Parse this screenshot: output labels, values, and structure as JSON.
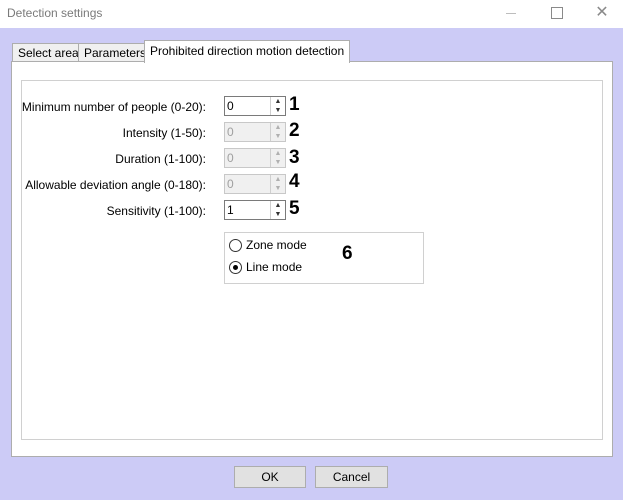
{
  "window": {
    "title": "Detection settings"
  },
  "tabs": [
    {
      "label": "Select area"
    },
    {
      "label": "Parameters"
    },
    {
      "label": "Prohibited direction motion detection"
    }
  ],
  "fields": [
    {
      "label": "Minimum number of people (0-20):",
      "value": "0",
      "enabled": true,
      "marker": "1"
    },
    {
      "label": "Intensity (1-50):",
      "value": "0",
      "enabled": false,
      "marker": "2"
    },
    {
      "label": "Duration (1-100):",
      "value": "0",
      "enabled": false,
      "marker": "3"
    },
    {
      "label": "Allowable deviation angle (0-180):",
      "value": "0",
      "enabled": false,
      "marker": "4"
    },
    {
      "label": "Sensitivity (1-100):",
      "value": "1",
      "enabled": true,
      "marker": "5"
    }
  ],
  "mode": {
    "options": [
      {
        "label": "Zone mode",
        "selected": false
      },
      {
        "label": "Line mode",
        "selected": true
      }
    ],
    "marker": "6"
  },
  "buttons": {
    "ok": "OK",
    "cancel": "Cancel"
  }
}
